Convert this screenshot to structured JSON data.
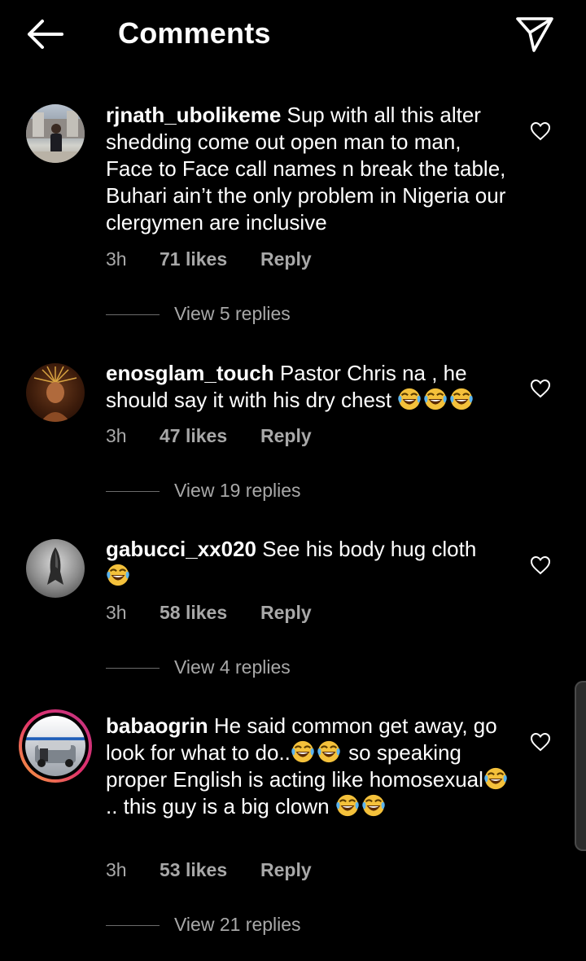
{
  "header": {
    "title": "Comments",
    "back_icon": "arrow-left-icon",
    "send_icon": "paper-plane-icon"
  },
  "comments": [
    {
      "username": "rjnath_ubolikeme",
      "text": " Sup with all this alter shedding come out open man to man, Face to Face call names n break the table, Buhari ain’t the only problem in Nigeria our clergymen are inclusive",
      "time": "3h",
      "likes": "71 likes",
      "reply": "Reply",
      "view_replies": "View 5 replies"
    },
    {
      "username": "enosglam_touch",
      "text": " Pastor Chris na , he should say it with his dry chest ",
      "emoji_tail": [
        "laugh-cry",
        "laugh-cry",
        "laugh-cry"
      ],
      "time": "3h",
      "likes": "47 likes",
      "reply": "Reply",
      "view_replies": "View 19 replies"
    },
    {
      "username": "gabucci_xx020",
      "text": " See his body hug cloth",
      "emoji_tail": [
        "laugh-cry"
      ],
      "time": "3h",
      "likes": "58 likes",
      "reply": "Reply",
      "view_replies": "View 4 replies"
    },
    {
      "username": "babaogrin",
      "text_parts": [
        " He said common get away, go look for what to do..",
        " so speaking proper English is acting like homosexual",
        ".. this guy is a big clown "
      ],
      "time": "3h",
      "likes": "53 likes",
      "reply": "Reply",
      "view_replies": "View 21 replies"
    }
  ],
  "colors": {
    "background": "#000000",
    "text": "#ffffff",
    "secondary": "#a8a8a8",
    "story_ring": "#e1306c"
  }
}
